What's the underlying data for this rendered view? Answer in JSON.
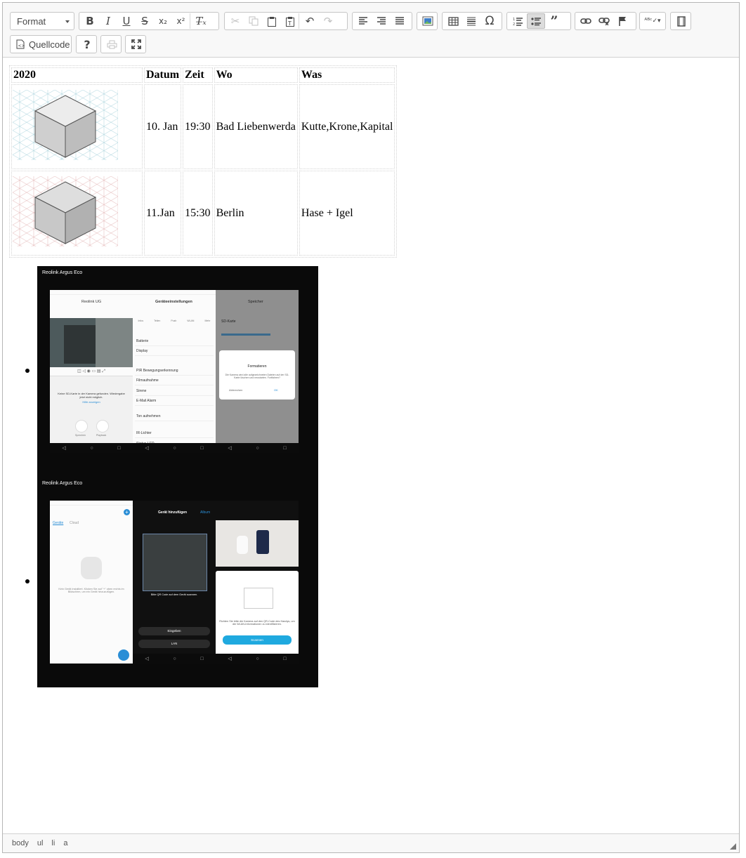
{
  "toolbar": {
    "format_label": "Format",
    "source_label": "Quellcode",
    "help_label": "?"
  },
  "table": {
    "headers": [
      "2020",
      "Datum",
      "Zeit",
      "Wo",
      "Was"
    ],
    "rows": [
      {
        "datum": "10. Jan",
        "zeit": "19:30",
        "wo": "Bad Liebenwerda",
        "was": "Kutte,Krone,Kapital"
      },
      {
        "datum": "11.Jan",
        "zeit": "15:30",
        "wo": "Berlin",
        "was": "Hase + Igel"
      }
    ]
  },
  "screenshots": [
    {
      "caption": "Reolink Argus Eco",
      "phone1": {
        "title": "Reolink UG",
        "message": "Keine SD-Karte in der Kamera gefunden. Wiedergabe jetzt nicht möglich.",
        "link": "Hilfe anzeigen",
        "buttons": [
          "Sprechen",
          "Playback"
        ]
      },
      "phone2": {
        "title": "Geräteeinstellungen",
        "tabs": [
          "Infos",
          "Teilen",
          "Push",
          "WLAN",
          "Mehr"
        ],
        "items": [
          "Batterie",
          "Display",
          "PIR Bewegungserkennung",
          "Filmaufnahme",
          "Sirene",
          "E-Mail Alarm",
          "Ton aufnehmen",
          "IR-Lichter",
          "Status-LED"
        ]
      },
      "phone3": {
        "title": "Speicher",
        "section": "SD-Karte",
        "dialog_title": "Formatieren",
        "dialog_text": "Die Kamera wird alle aufgezeichneten Dateien auf der SD-Karte löschen und neustarten. Fortfahren?",
        "cancel": "Abbrechen",
        "ok": "OK"
      }
    },
    {
      "caption": "Reolink Argus Eco",
      "phone1": {
        "tabs": [
          "Geräte",
          "Cloud"
        ],
        "message": "Kein Gerät installiert. Klicken Sie auf \"+\" oben rechts im Bildschirm, um ein Gerät hinzuzufügen."
      },
      "phone2": {
        "title": "Gerät hinzufügen",
        "album": "Album",
        "hint": "Bitte QR Code auf dem Gerät scannen.",
        "buttons": [
          "Eingeben",
          "LAN"
        ]
      },
      "phone3": {
        "text": "Richten Sie bitte die Kamera auf den QR-Code des Handys, um die WLAN-Informationen zu identifizieren.",
        "button": "Scannen"
      }
    }
  ],
  "statusbar": {
    "path": [
      "body",
      "ul",
      "li",
      "a"
    ]
  }
}
